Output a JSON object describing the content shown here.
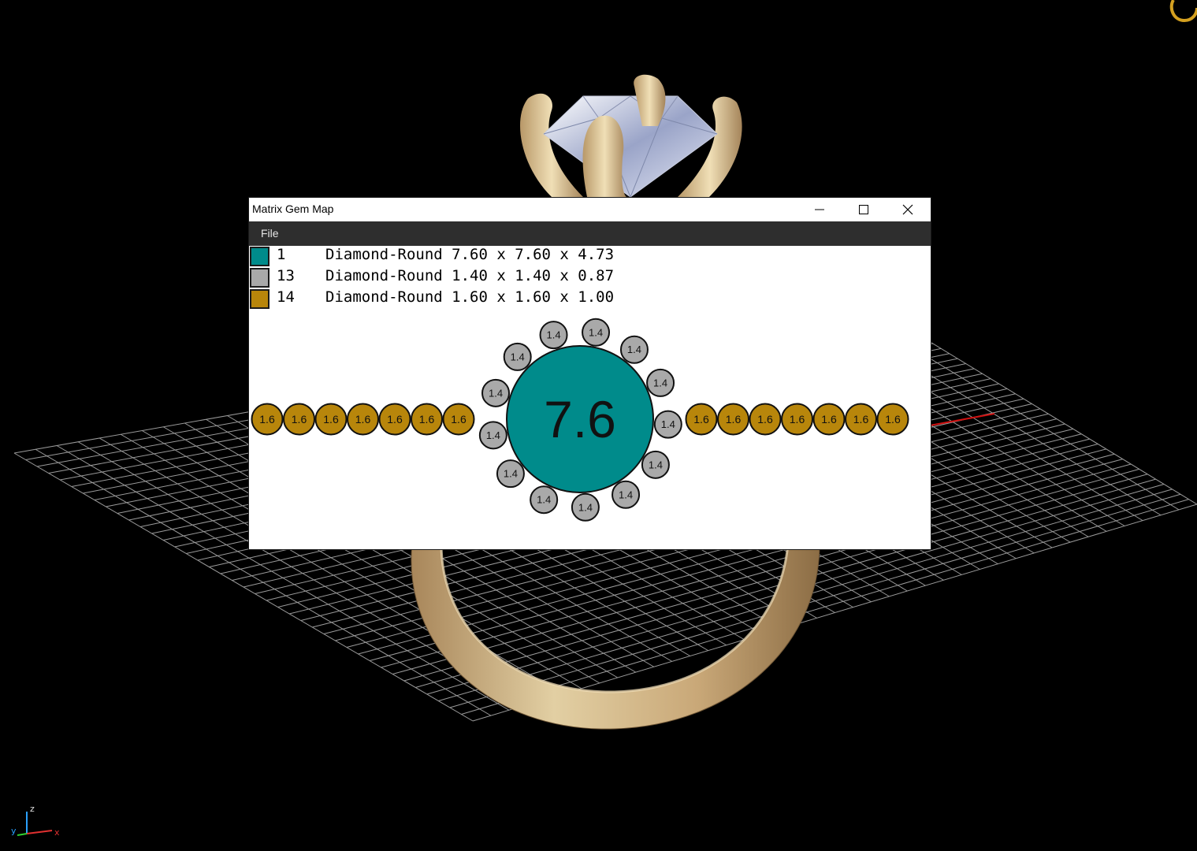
{
  "window": {
    "title": "Matrix Gem Map",
    "menu": {
      "file_label": "File"
    }
  },
  "legend": [
    {
      "count": "1",
      "description": "Diamond-Round 7.60 x 7.60 x 4.73",
      "color": "#008B8B"
    },
    {
      "count": "13",
      "description": "Diamond-Round 1.40 x 1.40 x 0.87",
      "color": "#A9A9A9"
    },
    {
      "count": "14",
      "description": "Diamond-Round 1.60 x 1.60 x 1.00",
      "color": "#B8860B"
    }
  ],
  "gem_map": {
    "center_stone": {
      "label": "7.6",
      "color": "#008B8B"
    },
    "halo": {
      "stone_label": "1.4",
      "count": 13,
      "color": "#A9A9A9"
    },
    "band_left": {
      "stone_label": "1.6",
      "count": 7,
      "color": "#B8860B"
    },
    "band_right": {
      "stone_label": "1.6",
      "count": 7,
      "color": "#B8860B"
    }
  },
  "axis": {
    "z_label": "z",
    "x_label": "x",
    "y_label": "y"
  },
  "colors": {
    "metal": "#D2B98A",
    "grid": "#9a9a9a",
    "menubar": "#2e2e2e"
  }
}
